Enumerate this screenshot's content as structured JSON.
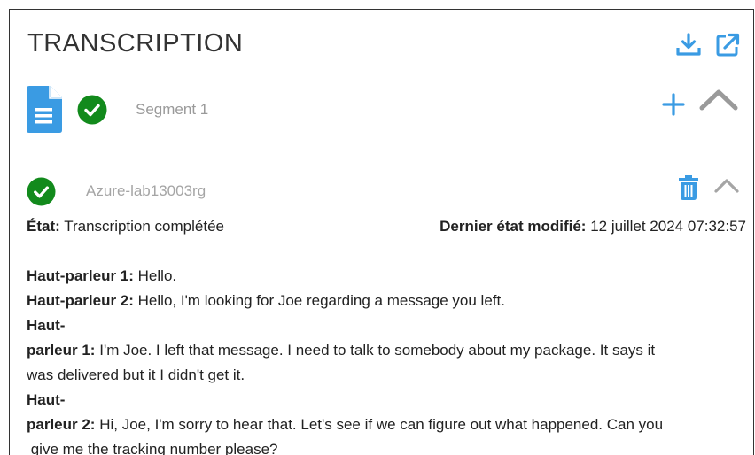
{
  "header": {
    "title": "TRANSCRIPTION",
    "download_icon": "download-icon",
    "external_icon": "open-external-icon"
  },
  "segment": {
    "label": "Segment 1",
    "file_icon": "document-icon",
    "status_icon": "check-circle-icon",
    "add_icon": "plus-icon",
    "collapse_icon": "chevron-up-icon"
  },
  "job": {
    "name": "Azure-lab13003rg",
    "status_icon": "check-circle-icon",
    "delete_icon": "trash-icon",
    "collapse_icon": "chevron-up-icon",
    "state_label": "État:",
    "state_value": "Transcription complétée",
    "modified_label": "Dernier état modifié:",
    "modified_value": "12 juillet 2024 07:32:57"
  },
  "transcript": [
    {
      "speaker": "Haut-parleur 1:",
      "text": "Hello."
    },
    {
      "speaker": "Haut-parleur 2:",
      "text": "Hello, I'm looking for Joe regarding a message you left."
    },
    {
      "speaker_top": "Haut-",
      "speaker": "parleur 1:",
      "text": "I'm Joe. I left that message. I need to talk to somebody about my package. It says it",
      "cont": "was delivered but it I didn't get it."
    },
    {
      "speaker_top": "Haut-",
      "speaker": "parleur 2:",
      "text": "Hi, Joe, I'm sorry to hear that. Let's see if we can figure out what happened. Can you",
      "cont": " give me the tracking number please?"
    }
  ],
  "colors": {
    "accent_blue": "#3a9be3",
    "success_green": "#128a1c",
    "muted_gray": "#a5a5a5"
  }
}
